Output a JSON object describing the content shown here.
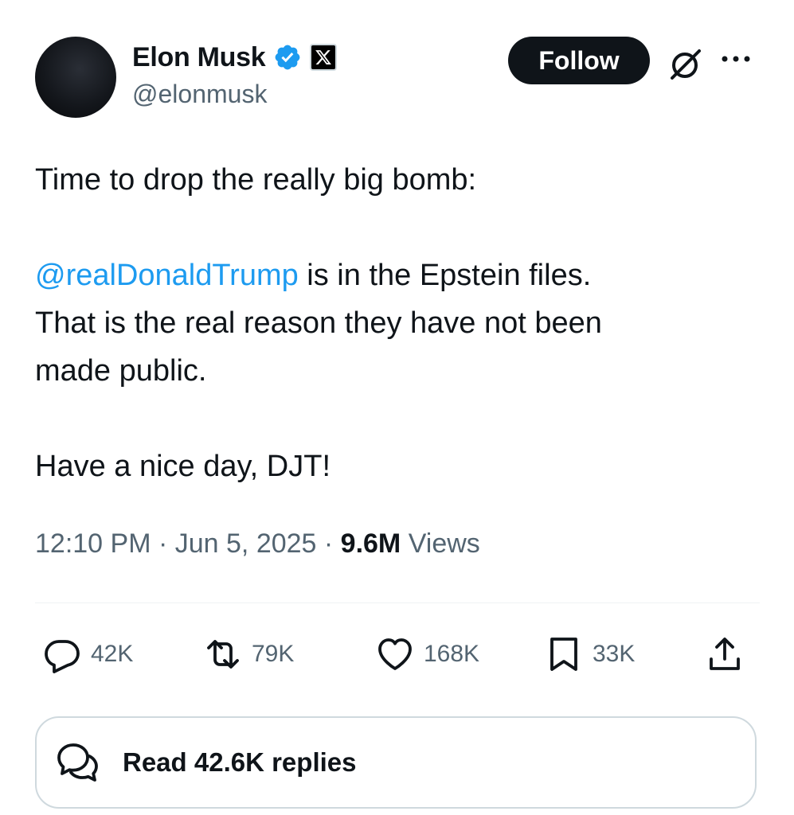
{
  "author": {
    "display_name": "Elon Musk",
    "handle": "@elonmusk",
    "verified_color": "#1d9bf0"
  },
  "header": {
    "follow_label": "Follow",
    "icons": [
      "grok-icon",
      "more-icon"
    ]
  },
  "tweet": {
    "line1": "Time to drop the really big bomb:",
    "mention": "@realDonaldTrump",
    "line2_rest": " is in the Epstein files.\nThat is the real reason they have not been\nmade public.",
    "line3": "Have a nice day, DJT!"
  },
  "meta": {
    "time": "12:10 PM",
    "date": "Jun 5, 2025",
    "views_count": "9.6M",
    "views_label": "Views",
    "separator": " · "
  },
  "actions": {
    "replies": "42K",
    "reposts": "79K",
    "likes": "168K",
    "bookmarks": "33K"
  },
  "read_replies_label": "Read 42.6K replies",
  "colors": {
    "accent": "#1d9bf0",
    "text": "#0f1419",
    "secondary": "#536471"
  }
}
